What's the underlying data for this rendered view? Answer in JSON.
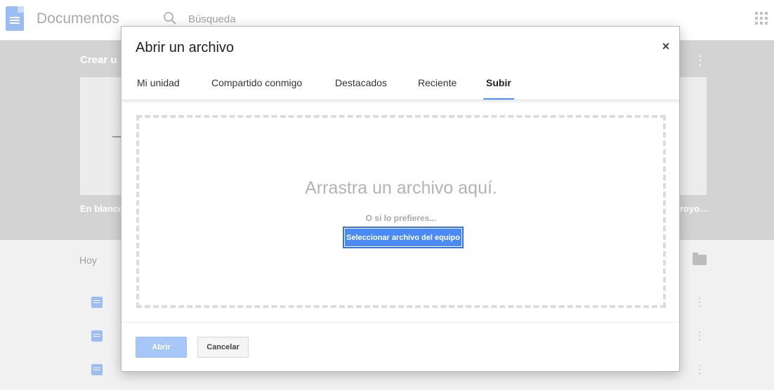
{
  "app": {
    "title": "Documentos",
    "search_placeholder": "Búsqueda",
    "today_label": "Hoy"
  },
  "background": {
    "create_label": "Crear u",
    "template_left_label": "En blanco",
    "template_right_label": "royo…"
  },
  "dialog": {
    "title": "Abrir un archivo",
    "close_label": "×",
    "tabs": [
      {
        "label": "Mi unidad",
        "active": false
      },
      {
        "label": "Compartido conmigo",
        "active": false
      },
      {
        "label": "Destacados",
        "active": false
      },
      {
        "label": "Reciente",
        "active": false
      },
      {
        "label": "Subir",
        "active": true
      }
    ],
    "drop_heading": "Arrastra un archivo aquí.",
    "drop_sub": "O si lo prefieres...",
    "select_button_label": "Seleccionar archivo del equipo",
    "open_button_label": "Abrir",
    "cancel_button_label": "Cancelar"
  },
  "colors": {
    "accent": "#4d90fe",
    "select_button": "#4a8af4",
    "open_button_disabled": "#a6c7f8"
  },
  "icons": {
    "close": "close-icon",
    "search": "search-icon",
    "apps": "apps-grid-icon",
    "folder": "folder-icon",
    "doc": "docs-icon"
  }
}
